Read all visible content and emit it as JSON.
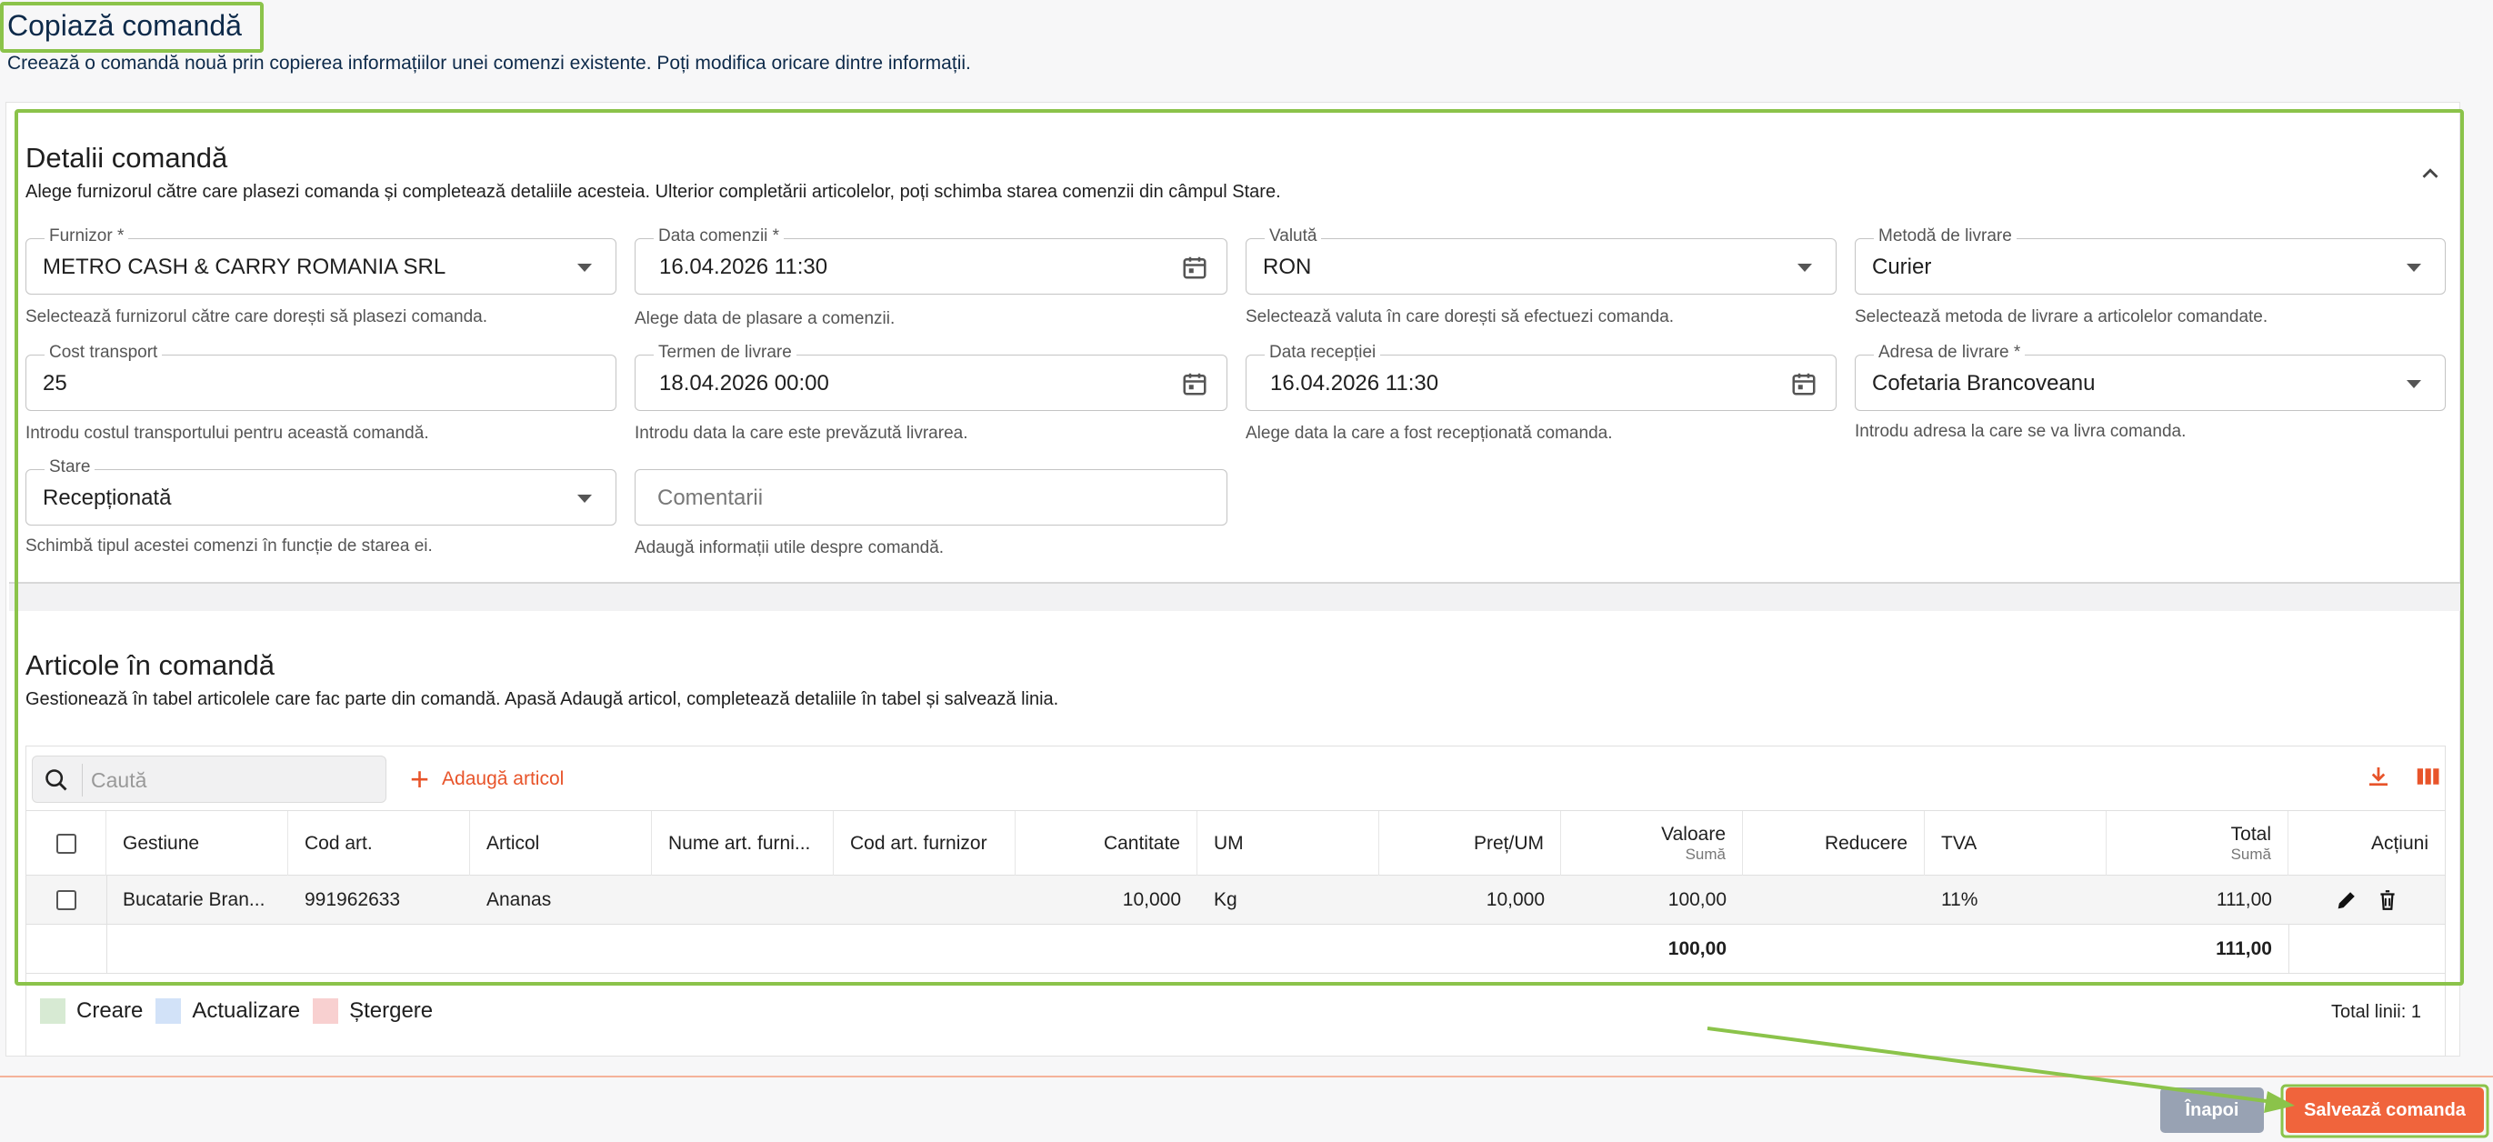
{
  "page": {
    "title": "Copiază comandă",
    "subtitle": "Creează o comandă nouă prin copierea informațiilor unei comenzi existente. Poți modifica oricare dintre informații."
  },
  "details": {
    "title": "Detalii comandă",
    "description": "Alege furnizorul către care plasezi comanda și completează detaliile acesteia. Ulterior completării articolelor, poți schimba starea comenzii din câmpul Stare.",
    "fields": {
      "furnizor": {
        "label": "Furnizor *",
        "value": "METRO CASH & CARRY ROMANIA SRL",
        "helper": "Selectează furnizorul către care dorești să plasezi comanda."
      },
      "data_comenzii": {
        "label": "Data comenzii *",
        "value": "16.04.2026 11:30",
        "helper": "Alege data de plasare a comenzii."
      },
      "valuta": {
        "label": "Valută",
        "value": "RON",
        "helper": "Selectează valuta în care dorești să efectuezi comanda."
      },
      "metoda_livrare": {
        "label": "Metodă de livrare",
        "value": "Curier",
        "helper": "Selectează metoda de livrare a articolelor comandate."
      },
      "cost_transport": {
        "label": "Cost transport",
        "value": "25",
        "helper": "Introdu costul transportului pentru această comandă."
      },
      "termen_livrare": {
        "label": "Termen de livrare",
        "value": "18.04.2026 00:00",
        "helper": "Introdu data la care este prevăzută livrarea."
      },
      "data_receptiei": {
        "label": "Data recepției",
        "value": "16.04.2026 11:30",
        "helper": "Alege data la care a fost recepționată comanda."
      },
      "adresa_livrare": {
        "label": "Adresa de livrare *",
        "value": "Cofetaria Brancoveanu",
        "helper": "Introdu adresa la care se va livra comanda."
      },
      "stare": {
        "label": "Stare",
        "value": "Recepționată",
        "helper": "Schimbă tipul acestei comenzi în funcție de starea ei."
      },
      "comentarii": {
        "placeholder": "Comentarii",
        "helper": "Adaugă informații utile despre comandă."
      }
    }
  },
  "articles": {
    "title": "Articole în comandă",
    "description": "Gestionează în tabel articolele care fac parte din comandă. Apasă Adaugă articol, completează detaliile în tabel și salvează linia.",
    "search_placeholder": "Caută",
    "add_label": "Adaugă articol",
    "columns": {
      "gestiune": "Gestiune",
      "cod_art": "Cod art.",
      "articol": "Articol",
      "nume_furnizor": "Nume art. furni...",
      "cod_furnizor": "Cod art. furnizor",
      "cantitate": "Cantitate",
      "um": "UM",
      "pret_um": "Preț/UM",
      "valoare": "Valoare",
      "valoare_sub": "Sumă",
      "reducere": "Reducere",
      "tva": "TVA",
      "total": "Total",
      "total_sub": "Sumă",
      "actiuni": "Acțiuni"
    },
    "rows": [
      {
        "gestiune": "Bucatarie Bran...",
        "cod_art": "991962633",
        "articol": "Ananas",
        "cantitate": "10,000",
        "um": "Kg",
        "pret_um": "10,000",
        "valoare": "100,00",
        "tva": "11%",
        "total": "111,00"
      }
    ],
    "footer": {
      "valoare": "100,00",
      "total": "111,00"
    },
    "legend": {
      "create": "Creare",
      "update": "Actualizare",
      "delete": "Ștergere"
    },
    "total_lines": "Total linii: 1"
  },
  "actions": {
    "back": "Înapoi",
    "save": "Salvează comanda"
  },
  "colors": {
    "accent": "#e8542a",
    "highlight": "#8bc34a",
    "legend_create": "#d7ead3",
    "legend_update": "#d2e2f8",
    "legend_delete": "#f8d0d0"
  }
}
